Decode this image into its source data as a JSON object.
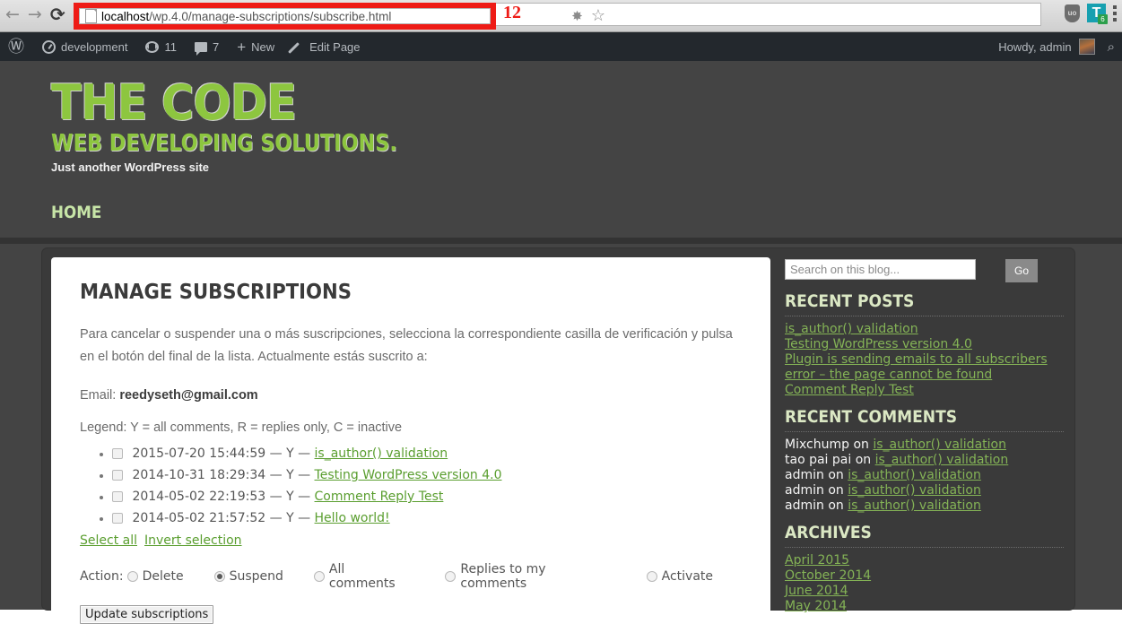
{
  "browser": {
    "back_icon": "back-arrow-icon",
    "forward_icon": "forward-arrow-icon",
    "reload_glyph": "⟳",
    "url_host": "localhost",
    "url_path": "/wp.4.0/manage-subscriptions/subscribe.html",
    "annotation_number": "12",
    "bug_glyph": "✸",
    "star_glyph": "☆",
    "shield_label": "uo",
    "ext_t_label": "T",
    "ext_t_badge": "6",
    "red_box_color": "#ee1b16"
  },
  "adminbar": {
    "wp_glyph": "Ⓦ",
    "site_name": "development",
    "revisions_count": "11",
    "comments_count": "7",
    "new_label": "New",
    "edit_page_label": "Edit Page",
    "howdy": "Howdy, admin",
    "search_glyph": "⌕"
  },
  "site": {
    "logo_line1": "THE CODE",
    "logo_line2": "WEB DEVELOPING SOLUTIONS.",
    "tagline": "Just another WordPress site",
    "nav": [
      {
        "label": "HOME"
      }
    ],
    "accent_green": "#8dc63f",
    "link_green": "#84b356",
    "heading_mint": "#dbe8c4"
  },
  "main": {
    "title": "MANAGE SUBSCRIPTIONS",
    "intro": "Para cancelar o suspender una o más suscripciones, selecciona la correspondiente casilla de verificación y pulsa en el botón del final de la lista. Actualmente estás suscrito a:",
    "email_label": "Email:",
    "email_value": "reedyseth@gmail.com",
    "legend": "Legend: Y = all comments, R = replies only, C = inactive",
    "subscriptions": [
      {
        "datetime": "2015-07-20 15:44:59",
        "flag": "Y",
        "post": "is_author() validation",
        "checked": false
      },
      {
        "datetime": "2014-10-31 18:29:34",
        "flag": "Y",
        "post": "Testing WordPress version 4.0",
        "checked": false
      },
      {
        "datetime": "2014-05-02 22:19:53",
        "flag": "Y",
        "post": "Comment Reply Test",
        "checked": false
      },
      {
        "datetime": "2014-05-02 21:57:52",
        "flag": "Y",
        "post": "Hello world!",
        "checked": false
      }
    ],
    "separator": "—",
    "select_all_label": "Select all",
    "invert_selection_label": "Invert selection",
    "action_label": "Action:",
    "actions": [
      {
        "label": "Delete",
        "selected": false
      },
      {
        "label": "Suspend",
        "selected": true
      },
      {
        "label": "All comments",
        "selected": false
      },
      {
        "label": "Replies to my comments",
        "selected": false
      },
      {
        "label": "Activate",
        "selected": false
      }
    ],
    "update_button": "Update subscriptions"
  },
  "sidebar": {
    "search_placeholder": "Search on this blog...",
    "search_value": "",
    "go_label": "Go",
    "recent_posts_title": "RECENT POSTS",
    "recent_posts": [
      "is_author() validation",
      "Testing WordPress version 4.0",
      "Plugin is sending emails to all subscribers",
      "error – the page cannot be found",
      "Comment Reply Test"
    ],
    "recent_comments_title": "RECENT COMMENTS",
    "recent_comments": [
      {
        "author": "Mixchump",
        "on": "on",
        "post": "is_author() validation"
      },
      {
        "author": "tao pai pai",
        "on": "on",
        "post": "is_author() validation"
      },
      {
        "author": "admin",
        "on": "on",
        "post": "is_author() validation"
      },
      {
        "author": "admin",
        "on": "on",
        "post": "is_author() validation"
      },
      {
        "author": "admin",
        "on": "on",
        "post": "is_author() validation"
      }
    ],
    "archives_title": "ARCHIVES",
    "archives": [
      "April 2015",
      "October 2014",
      "June 2014",
      "May 2014"
    ]
  }
}
